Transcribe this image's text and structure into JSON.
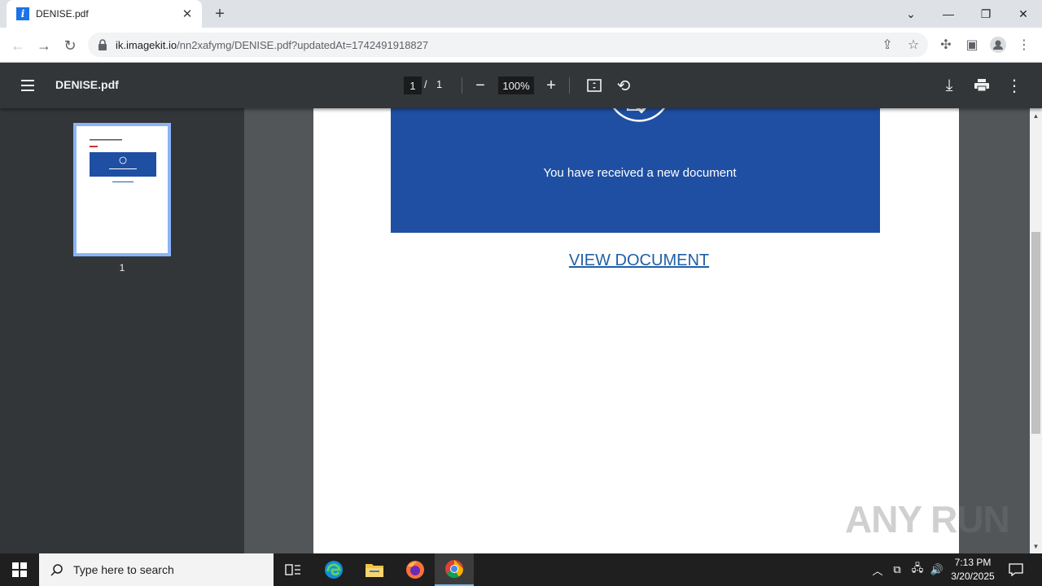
{
  "browser": {
    "tab_title": "DENISE.pdf",
    "tab_favicon_letter": "i",
    "url_host": "ik.imagekit.io",
    "url_path": "/nn2xafymg/DENISE.pdf?updatedAt=1742491918827"
  },
  "pdf_toolbar": {
    "file_name": "DENISE.pdf",
    "current_page": "1",
    "page_separator": "/",
    "total_pages": "1",
    "zoom": "100%"
  },
  "sidebar": {
    "thumbnail_page_number": "1"
  },
  "document": {
    "banner_message": "You have received a new document",
    "link_text": "VIEW DOCUMENT",
    "banner_color": "#1f4fa3",
    "link_color": "#1f5fa8"
  },
  "watermark": "ANY RUN",
  "taskbar": {
    "search_placeholder": "Type here to search",
    "time": "7:13 PM",
    "date": "3/20/2025"
  }
}
